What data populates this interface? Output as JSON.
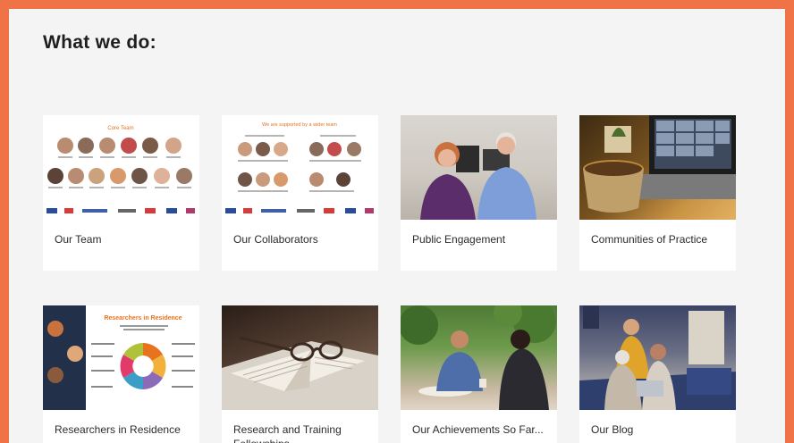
{
  "section": {
    "title": "What we do:"
  },
  "cards": [
    {
      "label": "Our Team",
      "thumb_title": "Core Team"
    },
    {
      "label": "Our Collaborators",
      "thumb_title": "We are supported by a wider team"
    },
    {
      "label": "Public Engagement"
    },
    {
      "label": "Communities of Practice"
    },
    {
      "label": "Researchers in Residence",
      "thumb_title": "Researchers in Residence"
    },
    {
      "label": "Research and Training Fellowships"
    },
    {
      "label": "Our Achievements So Far..."
    },
    {
      "label": "Our Blog"
    }
  ],
  "colors": {
    "border": "#f07247",
    "panel": "#f4f4f4",
    "accent": "#e8731e"
  }
}
